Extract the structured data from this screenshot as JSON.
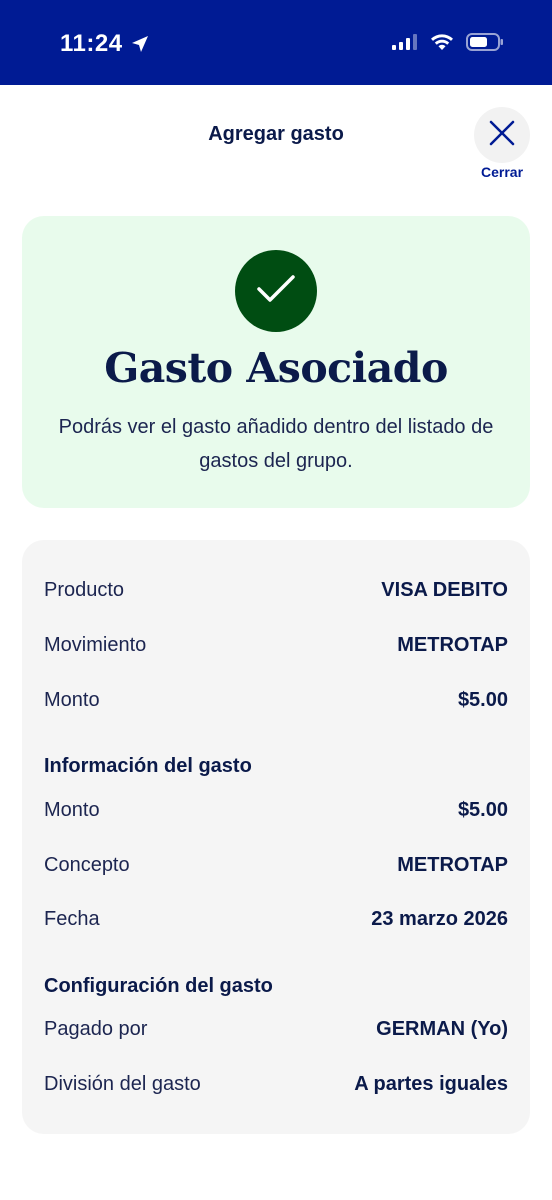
{
  "status_bar": {
    "time": "11:24",
    "icons": [
      "location-arrow-icon",
      "cellular-signal-icon",
      "wifi-icon",
      "battery-icon"
    ]
  },
  "header": {
    "title": "Agregar gasto",
    "close_label": "Cerrar"
  },
  "success": {
    "title": "Gasto Asociado",
    "description": "Podrás ver el gasto añadido dentro del listado de gastos del grupo."
  },
  "details": {
    "movement": [
      {
        "label": "Producto",
        "value": "VISA DEBITO"
      },
      {
        "label": "Movimiento",
        "value": "METROTAP"
      },
      {
        "label": "Monto",
        "value": "$5.00"
      }
    ],
    "expense_info": {
      "title": "Información del gasto",
      "rows": [
        {
          "label": "Monto",
          "value": "$5.00"
        },
        {
          "label": "Concepto",
          "value": "METROTAP"
        },
        {
          "label": "Fecha",
          "value": "23 marzo 2026"
        }
      ]
    },
    "expense_config": {
      "title": "Configuración del gasto",
      "rows": [
        {
          "label": "Pagado por",
          "value": "GERMAN (Yo)"
        },
        {
          "label": "División del gasto",
          "value": "A partes iguales"
        }
      ]
    }
  },
  "colors": {
    "status_bar": "#001b94",
    "success_bg": "#e8fbec",
    "check_circle": "#004d12",
    "card_bg": "#f5f5f5",
    "text_primary": "#0b1a4a",
    "accent": "#001b94"
  }
}
